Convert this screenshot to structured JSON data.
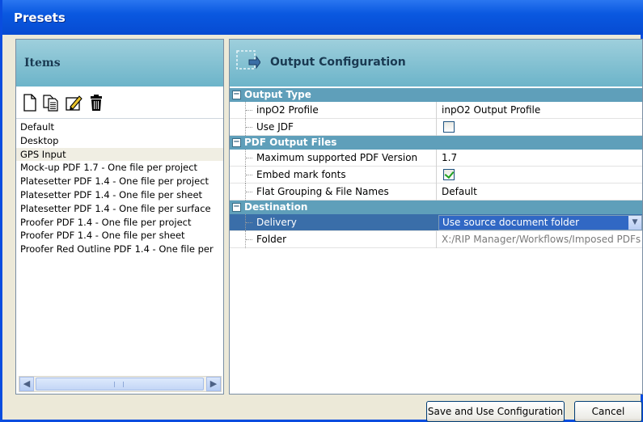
{
  "window": {
    "title": "Presets"
  },
  "items_panel": {
    "title": "Items",
    "items": [
      "Default",
      "Desktop",
      "GPS Input",
      "Mock-up PDF 1.7 - One file per project",
      "Platesetter PDF 1.4 - One file per project",
      "Platesetter PDF 1.4 - One file per sheet",
      "Platesetter PDF 1.4 - One file per surface",
      "Proofer PDF 1.4 - One file per project",
      "Proofer PDF 1.4 - One file per sheet",
      "Proofer Red Outline PDF 1.4 - One file per"
    ],
    "selected_item": "GPS Input",
    "toolbar_icons": [
      "new-document-icon",
      "copy-document-icon",
      "edit-icon",
      "trash-icon"
    ]
  },
  "config_panel": {
    "title": "Output Configuration",
    "sections": {
      "output_type": {
        "label": "Output Type",
        "rows": {
          "profile": {
            "name": "inpO2 Profile",
            "value": "inpO2 Output Profile"
          },
          "use_jdf": {
            "name": "Use JDF",
            "checked": false
          }
        }
      },
      "pdf_output": {
        "label": "PDF Output Files",
        "rows": {
          "max_version": {
            "name": "Maximum supported PDF Version",
            "value": "1.7"
          },
          "embed_fonts": {
            "name": "Embed mark fonts",
            "checked": true
          },
          "flat_grouping": {
            "name": "Flat Grouping & File Names",
            "value": "Default"
          }
        }
      },
      "destination": {
        "label": "Destination",
        "rows": {
          "delivery": {
            "name": "Delivery",
            "value": "Use source document folder"
          },
          "folder": {
            "name": "Folder",
            "value": "X:/RIP Manager/Workflows/Imposed PDFs"
          }
        }
      }
    }
  },
  "buttons": {
    "save": "Save and Use Configuration",
    "cancel": "Cancel"
  },
  "colors": {
    "titlebar": "#0a58e0",
    "panel_header": "#8ec4d4",
    "section_header": "#5f9fba",
    "selection": "#3168c4"
  }
}
